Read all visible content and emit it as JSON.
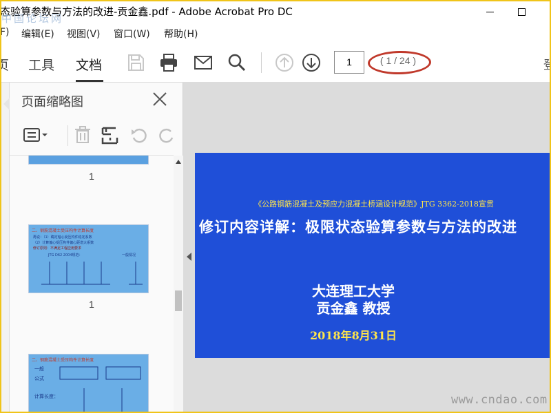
{
  "window": {
    "title": "态验算参数与方法的改进-贡金鑫.pdf - Adobe Acrobat Pro DC",
    "top_left_watermark": "中国论坛网"
  },
  "menu": {
    "items": [
      {
        "label": "F)"
      },
      {
        "label": "编辑(E)"
      },
      {
        "label": "视图(V)"
      },
      {
        "label": "窗口(W)"
      },
      {
        "label": "帮助(H)"
      }
    ]
  },
  "toolbar": {
    "tab_cut": "页",
    "tab_tools": "工具",
    "tab_document": "文档",
    "page_number": "1",
    "page_count": "( 1 / 24 )",
    "right_cut": "登"
  },
  "panel": {
    "title": "页面缩略图",
    "thumbnails": [
      {
        "label": "1"
      },
      {
        "label": "1",
        "title": "二、钢筋混凝土受压构件计算长度",
        "lines": [
          "再说：（1）确定轴心受压构件稳定系数",
          "（2）计算偏心受压构件偏心距增大系数",
          "修订原则：不满足工程应用要求",
          "JTG D62 2004规范：",
          "一般情况"
        ]
      },
      {
        "label": "",
        "title": "二、钢筋混凝土受压构件计算长度",
        "lines": [
          "一般",
          "公式",
          "计算长度："
        ]
      }
    ]
  },
  "slide": {
    "subtitle": "《公路钢筋混凝土及预应力混凝土桥涵设计规范》JTG 3362-2018宣贯",
    "main_title": "修订内容详解：极限状态验算参数与方法的改进",
    "university": "大连理工大学",
    "author": "贡金鑫 教授",
    "date": "2018年8月31日"
  },
  "watermark_bottom": "www.cndao.com",
  "colors": {
    "slide_bg": "#1f4fd8",
    "slide_accent": "#ffe64a",
    "annotation_oval": "#c0392b",
    "frame": "#f0c419"
  }
}
